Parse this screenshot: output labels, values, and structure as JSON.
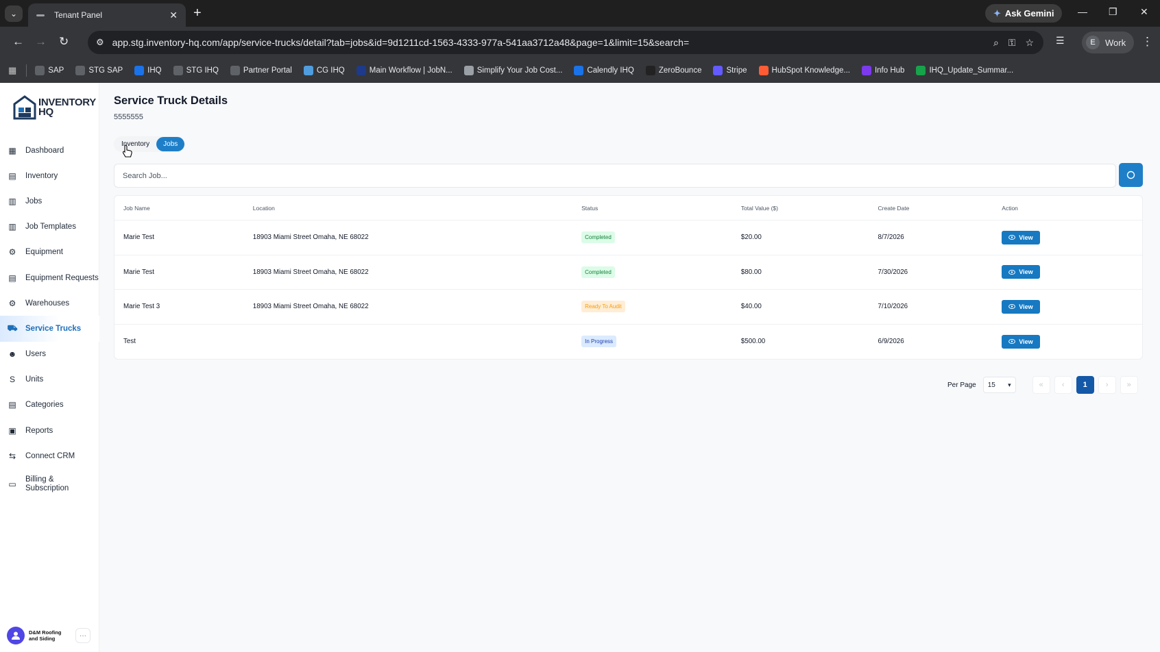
{
  "browser": {
    "tab_title": "Tenant Panel",
    "new_tab": "+",
    "ask_gemini": "Ask Gemini",
    "url": "app.stg.inventory-hq.com/app/service-trucks/detail?tab=jobs&id=9d1211cd-1563-4333-977a-541aa3712a48&page=1&limit=15&search=",
    "profile_initial": "E",
    "profile_label": "Work",
    "bookmarks": [
      {
        "label": "SAP",
        "color": "#5f6368"
      },
      {
        "label": "STG SAP",
        "color": "#5f6368"
      },
      {
        "label": "IHQ",
        "color": "#1a73e8"
      },
      {
        "label": "STG IHQ",
        "color": "#5f6368"
      },
      {
        "label": "Partner Portal",
        "color": "#5f6368"
      },
      {
        "label": "CG IHQ",
        "color": "#4f9dde"
      },
      {
        "label": "Main Workflow | JobN...",
        "color": "#1e3a8a"
      },
      {
        "label": "Simplify Your Job Cost...",
        "color": "#9aa0a6"
      },
      {
        "label": "Calendly IHQ",
        "color": "#1a73e8"
      },
      {
        "label": "ZeroBounce",
        "color": "#222222"
      },
      {
        "label": "Stripe",
        "color": "#635bff"
      },
      {
        "label": "HubSpot Knowledge...",
        "color": "#ff5c35"
      },
      {
        "label": "Info Hub",
        "color": "#7c3aed"
      },
      {
        "label": "IHQ_Update_Summar...",
        "color": "#16a34a"
      }
    ]
  },
  "sidebar": {
    "logo_line1": "INVENTORY",
    "logo_line2": "HQ",
    "items": [
      {
        "label": "Dashboard",
        "icon": "dashboard-icon"
      },
      {
        "label": "Inventory",
        "icon": "inventory-icon"
      },
      {
        "label": "Jobs",
        "icon": "jobs-icon"
      },
      {
        "label": "Job Templates",
        "icon": "job-templates-icon"
      },
      {
        "label": "Equipment",
        "icon": "equipment-icon"
      },
      {
        "label": "Equipment Requests",
        "icon": "equipment-requests-icon"
      },
      {
        "label": "Warehouses",
        "icon": "warehouses-icon"
      },
      {
        "label": "Service Trucks",
        "icon": "truck-icon"
      },
      {
        "label": "Users",
        "icon": "users-icon"
      },
      {
        "label": "Units",
        "icon": "units-icon"
      },
      {
        "label": "Categories",
        "icon": "categories-icon"
      },
      {
        "label": "Reports",
        "icon": "reports-icon"
      },
      {
        "label": "Connect CRM",
        "icon": "connect-crm-icon"
      },
      {
        "label": "Billing & Subscription",
        "icon": "billing-icon"
      }
    ],
    "org_name": "D&M Roofing and Siding",
    "more": "···"
  },
  "page": {
    "title": "Service Truck Details",
    "subtitle": "5555555",
    "tabs": [
      "Inventory",
      "Jobs"
    ],
    "active_tab": "Jobs",
    "search_placeholder": "Search Job..."
  },
  "table": {
    "headers": [
      "Job Name",
      "Location",
      "Status",
      "Total Value ($)",
      "Create Date",
      "Action"
    ],
    "rows": [
      {
        "name": "Marie Test",
        "location": "18903 Miami Street Omaha, NE 68022",
        "status": "Completed",
        "status_color": "green",
        "value": "$20.00",
        "date": "8/7/2026",
        "action": "View"
      },
      {
        "name": "Marie Test",
        "location": "18903 Miami Street Omaha, NE 68022",
        "status": "Completed",
        "status_color": "green",
        "value": "$80.00",
        "date": "7/30/2026",
        "action": "View"
      },
      {
        "name": "Marie Test 3",
        "location": "18903 Miami Street Omaha, NE 68022",
        "status": "Ready To Audit",
        "status_color": "orange",
        "value": "$40.00",
        "date": "7/10/2026",
        "action": "View"
      },
      {
        "name": "Test",
        "location": "",
        "status": "In Progress",
        "status_color": "blue",
        "value": "$500.00",
        "date": "6/9/2026",
        "action": "View"
      }
    ]
  },
  "pagination": {
    "per_page_label": "Per Page",
    "per_page_value": "15",
    "first": "«",
    "prev": "‹",
    "current_page": "1",
    "next": "›",
    "last": "»"
  }
}
